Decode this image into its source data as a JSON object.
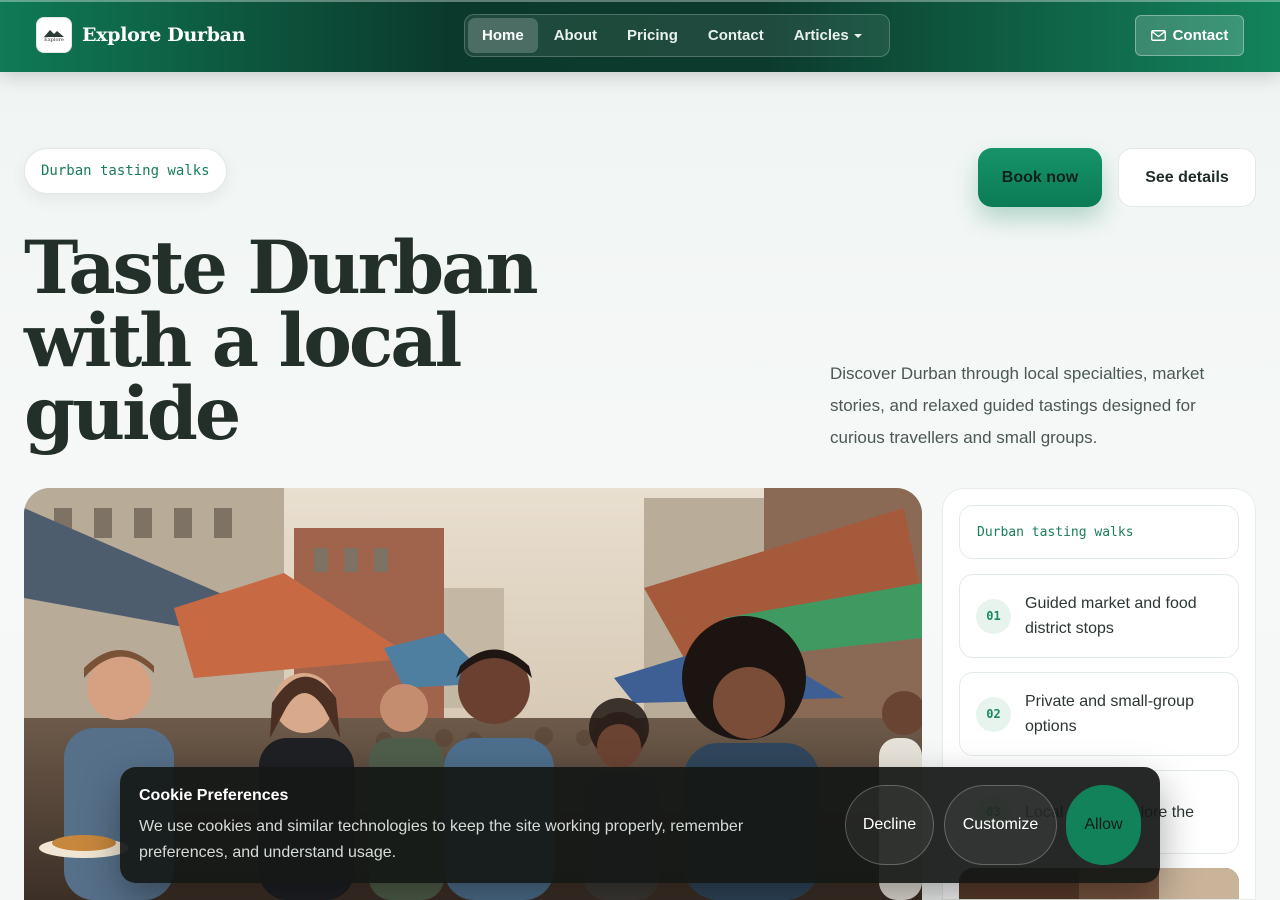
{
  "nav": {
    "brand": "Explore Durban",
    "logo_text": "Explore",
    "items": [
      {
        "label": "Home",
        "active": true
      },
      {
        "label": "About",
        "active": false
      },
      {
        "label": "Pricing",
        "active": false
      },
      {
        "label": "Contact",
        "active": false
      },
      {
        "label": "Articles",
        "active": false
      }
    ],
    "contact_label": "Contact"
  },
  "hero": {
    "tag": "Durban tasting walks",
    "book_label": "Book now",
    "details_label": "See details",
    "headline": "Taste Durban with a local guide",
    "lead": "Discover Durban through local specialties, market stories, and relaxed guided tastings designed for curious travellers and small groups."
  },
  "side": {
    "tag": "Durban tasting walks",
    "features": [
      {
        "num": "01",
        "text": "Guided market and food district stops"
      },
      {
        "num": "02",
        "text": "Private and small-group options"
      },
      {
        "num": "03",
        "text": "Local tips to explore the"
      }
    ]
  },
  "cookie": {
    "title": "Cookie Preferences",
    "text": "We use cookies and similar technologies to keep the site working properly, remember preferences, and understand usage.",
    "decline": "Decline",
    "customize": "Customize",
    "allow": "Allow"
  },
  "colors": {
    "accent": "#12825b",
    "nav_dark": "#0b3a2c",
    "tag_text": "#1a7d58"
  },
  "icons": {
    "contact": "mail-icon",
    "articles": "chevron-down-icon"
  }
}
